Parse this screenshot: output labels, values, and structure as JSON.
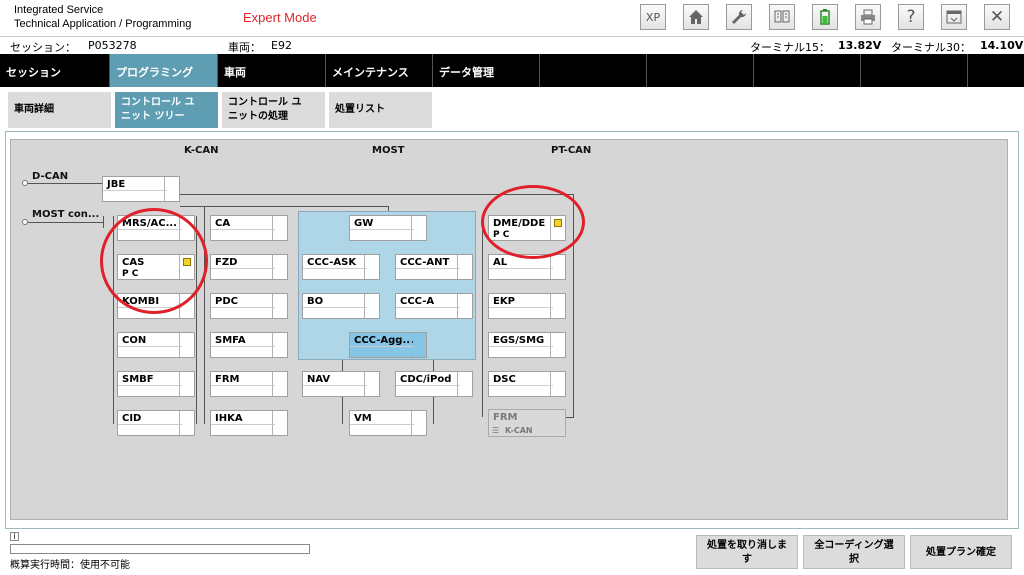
{
  "header": {
    "app_line1": "Integrated Service",
    "app_line2": "Technical Application / Programming",
    "mode": "Expert Mode",
    "toolbar": [
      {
        "label": "XP",
        "icon": "xp-icon"
      },
      {
        "label": "",
        "icon": "home-icon"
      },
      {
        "label": "",
        "icon": "wrench-icon"
      },
      {
        "label": "",
        "icon": "ecu-compare-icon"
      },
      {
        "label": "",
        "icon": "battery-icon"
      },
      {
        "label": "",
        "icon": "printer-icon"
      },
      {
        "label": "?",
        "icon": "help-icon"
      },
      {
        "label": "",
        "icon": "window-icon"
      },
      {
        "label": "✕",
        "icon": "close-icon"
      }
    ]
  },
  "session": {
    "session_label": "セッション：",
    "session_value": "P053278",
    "vehicle_label": "車両：",
    "vehicle_value": "E92",
    "terminal15_label": "ターミナル15：",
    "terminal15_value": "13.82V",
    "terminal30_label": "ターミナル30：",
    "terminal30_value": "14.10V"
  },
  "mainnav": [
    "セッション",
    "プログラミング",
    "車両",
    "メインテナンス",
    "データ管理",
    "",
    "",
    "",
    "",
    ""
  ],
  "subtabs": {
    "t1": "車両詳細",
    "t2a": "コントロール ユ",
    "t2b": "ニット ツリー",
    "t3a": "コントロール ユ",
    "t3b": "ニットの処理",
    "t4": "処置リスト"
  },
  "diagram": {
    "bus_kcan": "K-CAN",
    "bus_most": "MOST",
    "bus_ptcan": "PT-CAN",
    "dcan": "D-CAN",
    "mostcon": "MOST con...",
    "ecus": {
      "jbe": "JBE",
      "mrs": "MRS/AC...",
      "cas": "CAS",
      "cas_sub": "P C",
      "kombi": "KOMBI",
      "con": "CON",
      "smbf": "SMBF",
      "cid": "CID",
      "ca": "CA",
      "fzd": "FZD",
      "pdc": "PDC",
      "smfa": "SMFA",
      "frm": "FRM",
      "ihka": "IHKA",
      "gw": "GW",
      "cccask": "CCC-ASK",
      "cccant": "CCC-ANT",
      "bo": "BO",
      "ccca": "CCC-A",
      "cccagg": "CCC-Agg...",
      "nav": "NAV",
      "cdc": "CDC/iPod",
      "vm": "VM",
      "dme": "DME/DDE",
      "dme_sub": "P C",
      "al": "AL",
      "ekp": "EKP",
      "egs": "EGS/SMG",
      "dsc": "DSC",
      "frm2": "FRM",
      "frm2_sub": "K-CAN"
    }
  },
  "bottom": {
    "runtime": "概算実行時間：使用不可能",
    "btn_cancel_a": "処置を取り消しま",
    "btn_cancel_b": "す",
    "btn_allcoding_a": "全コーディング選",
    "btn_allcoding_b": "択",
    "btn_confirm": "処置プラン確定"
  }
}
